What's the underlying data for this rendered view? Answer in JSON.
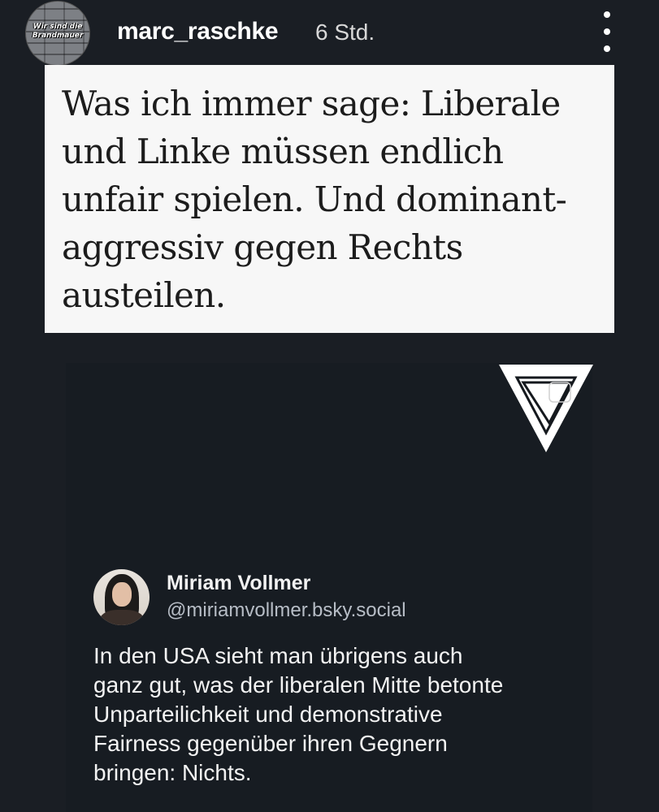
{
  "header": {
    "avatar_text": "Wir sind die Brandmauer",
    "username": "marc_raschke",
    "time": "6 Std."
  },
  "quote": {
    "text": "Was ich immer sage: Liberale\nund Linke müssen endlich\nunfair spielen. Und dominant-\naggressiv gegen Rechts\nausteilen."
  },
  "post": {
    "author_name": "Miriam Vollmer",
    "author_handle": "@miriamvollmer.bsky.social",
    "body": "In den USA sieht man übrigens auch\nganz gut, was der liberalen Mitte betonte\nUnparteilichkeit und demonstrative\nFairness gegenüber ihren Gegnern\nbringen: Nichts."
  },
  "icons": {
    "more": "more-vertical-icon",
    "logo": "inverted-triangle-logo-icon"
  },
  "colors": {
    "background": "#1a1e24",
    "quote_box": "#f7f7f7",
    "text_primary": "#ffffff",
    "text_secondary": "#b7bdc6"
  }
}
